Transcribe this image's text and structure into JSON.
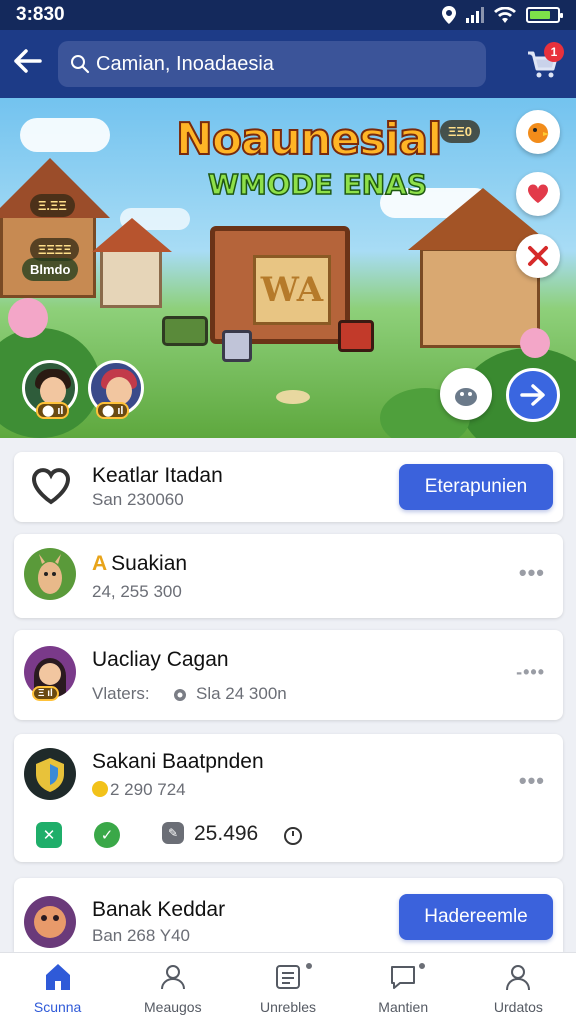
{
  "status_bar": {
    "time": "3:830"
  },
  "header": {
    "search_value": "Camian, Inoadaesia",
    "cart_badge": "1"
  },
  "banner": {
    "title_line1": "Noaunesial",
    "title_line2": "WMODE ENAS",
    "crate_label": "WA",
    "left_pills": [
      "Ξ.ΞΞ",
      "ΞΞΞΞ",
      "Blmdo"
    ],
    "right_pill": "ΞΞ0"
  },
  "cards": [
    {
      "title": "Keatlar Itadan",
      "subtitle": "San 230060",
      "button_label": "Eterapunien"
    },
    {
      "title_prefix": "A",
      "title": "Suakian",
      "subtitle": "24, 255 300"
    },
    {
      "title": "Uacliay Cagan",
      "subtitle_label": "Vlaters:",
      "subtitle_value": "Sla 24 300n"
    },
    {
      "title": "Sakani Baatpnden",
      "subtitle": "2 290 724",
      "stat_value": "25.496"
    },
    {
      "title": "Banak Keddar",
      "subtitle": "Ban 268 Y40",
      "button_label": "Hadereemle"
    }
  ],
  "bottom_nav": [
    {
      "label": "Scunna",
      "icon": "home-icon",
      "active": true
    },
    {
      "label": "Meaugos",
      "icon": "group-icon",
      "active": false
    },
    {
      "label": "Unrebles",
      "icon": "list-icon",
      "active": false
    },
    {
      "label": "Mantien",
      "icon": "chat-icon",
      "active": false
    },
    {
      "label": "Urdatos",
      "icon": "person-icon",
      "active": false
    }
  ],
  "colors": {
    "header": "#1d3b87",
    "accent": "#3b62dc",
    "badge": "#e8313c"
  }
}
